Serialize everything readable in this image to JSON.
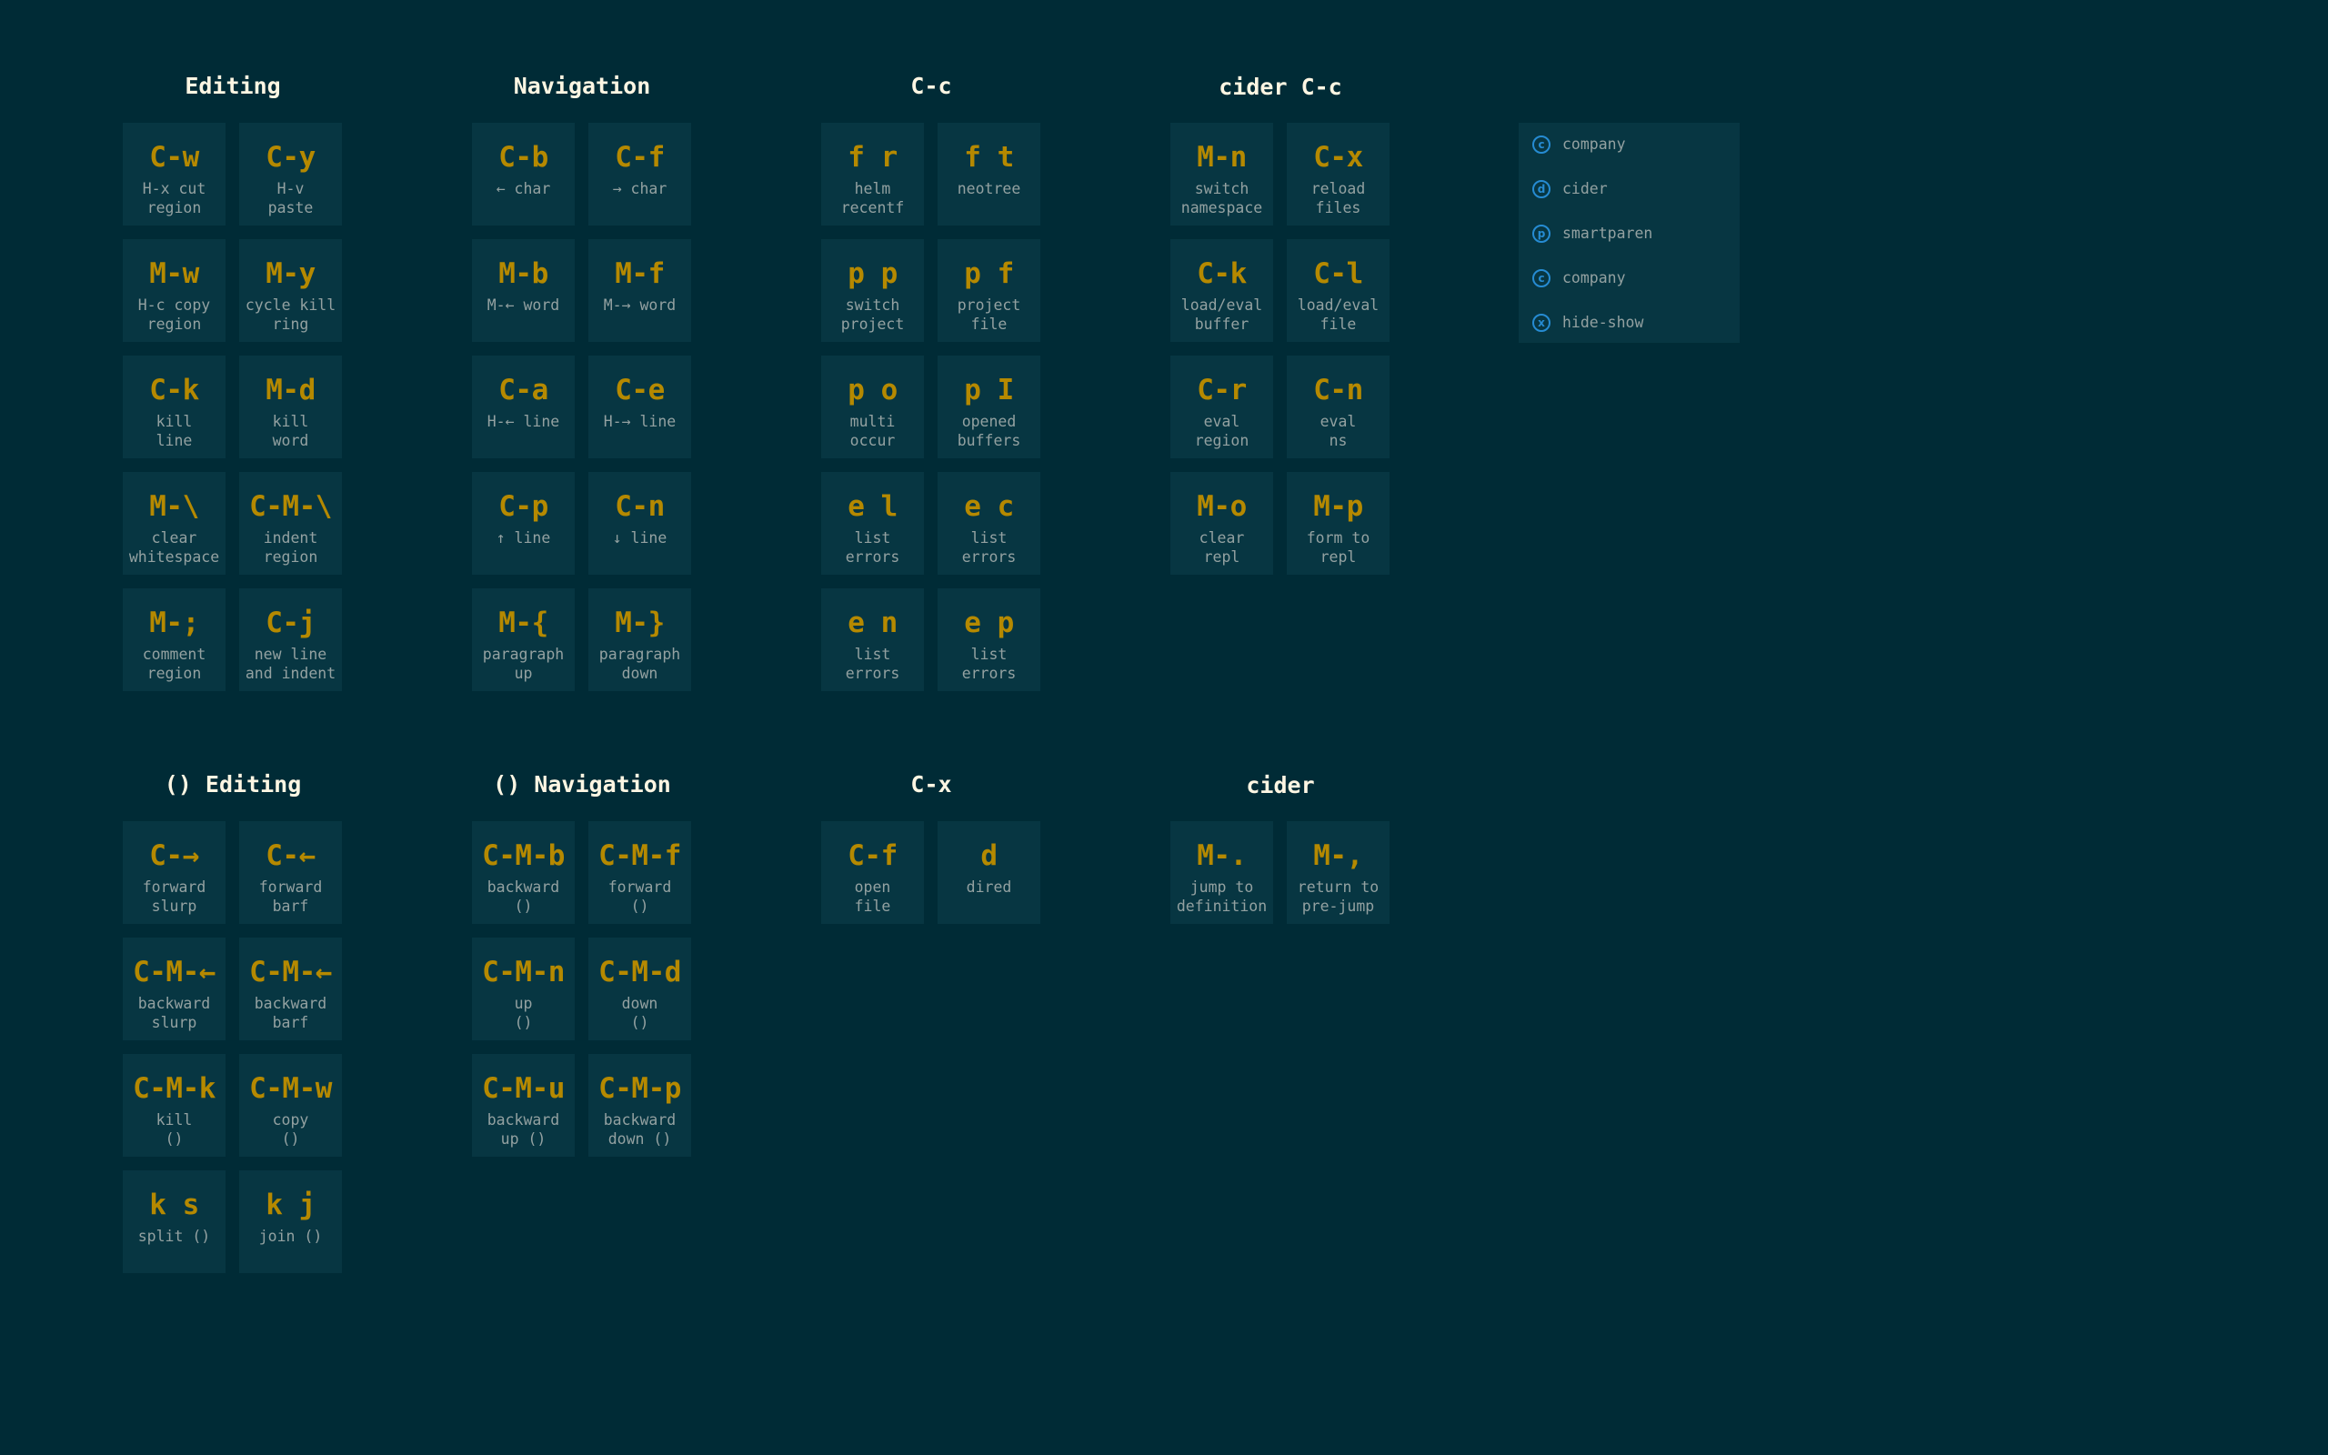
{
  "groups": [
    {
      "id": "editing",
      "title": "Editing",
      "tiles": [
        {
          "key": "C-w",
          "desc": "H-x cut\nregion"
        },
        {
          "key": "C-y",
          "desc": "H-v\npaste"
        },
        {
          "key": "M-w",
          "desc": "H-c copy\nregion"
        },
        {
          "key": "M-y",
          "desc": "cycle kill\nring"
        },
        {
          "key": "C-k",
          "desc": "kill\nline"
        },
        {
          "key": "M-d",
          "desc": "kill\nword"
        },
        {
          "key": "M-\\",
          "desc": "clear\nwhitespace"
        },
        {
          "key": "C-M-\\",
          "desc": "indent\nregion"
        },
        {
          "key": "M-;",
          "desc": "comment\nregion"
        },
        {
          "key": "C-j",
          "desc": "new line\nand indent"
        }
      ]
    },
    {
      "id": "navigation",
      "title": "Navigation",
      "tiles": [
        {
          "key": "C-b",
          "desc": "← char"
        },
        {
          "key": "C-f",
          "desc": "→ char"
        },
        {
          "key": "M-b",
          "desc": "M-← word"
        },
        {
          "key": "M-f",
          "desc": "M-→ word"
        },
        {
          "key": "C-a",
          "desc": "H-← line"
        },
        {
          "key": "C-e",
          "desc": "H-→ line"
        },
        {
          "key": "C-p",
          "desc": "↑ line"
        },
        {
          "key": "C-n",
          "desc": "↓ line"
        },
        {
          "key": "M-{",
          "desc": "paragraph\nup"
        },
        {
          "key": "M-}",
          "desc": "paragraph\ndown"
        }
      ]
    },
    {
      "id": "c-c",
      "title": "C-c",
      "tiles": [
        {
          "key": "f r",
          "desc": "helm\nrecentf"
        },
        {
          "key": "f t",
          "desc": "neotree"
        },
        {
          "key": "p p",
          "desc": "switch\nproject"
        },
        {
          "key": "p f",
          "desc": "project\nfile"
        },
        {
          "key": "p o",
          "desc": "multi\noccur"
        },
        {
          "key": "p I",
          "desc": "opened\nbuffers"
        },
        {
          "key": "e l",
          "desc": "list\nerrors"
        },
        {
          "key": "e c",
          "desc": "list\nerrors"
        },
        {
          "key": "e n",
          "desc": "list\nerrors"
        },
        {
          "key": "e p",
          "desc": "list\nerrors"
        }
      ]
    },
    {
      "id": "cider-c-c",
      "title": "cider C-c",
      "tiles": [
        {
          "key": "M-n",
          "desc": "switch\nnamespace"
        },
        {
          "key": "C-x",
          "desc": "reload\nfiles"
        },
        {
          "key": "C-k",
          "desc": "load/eval\nbuffer"
        },
        {
          "key": "C-l",
          "desc": "load/eval\nfile"
        },
        {
          "key": "C-r",
          "desc": "eval\nregion"
        },
        {
          "key": "C-n",
          "desc": "eval\nns"
        },
        {
          "key": "M-o",
          "desc": "clear\nrepl"
        },
        {
          "key": "M-p",
          "desc": "form to\nrepl"
        }
      ]
    },
    {
      "id": "paren-editing",
      "title": "() Editing",
      "tiles": [
        {
          "key": "C-→",
          "desc": "forward\nslurp"
        },
        {
          "key": "C-←",
          "desc": "forward\nbarf"
        },
        {
          "key": "C-M-←",
          "desc": "backward\nslurp"
        },
        {
          "key": "C-M-←",
          "desc": "backward\nbarf"
        },
        {
          "key": "C-M-k",
          "desc": "kill\n()"
        },
        {
          "key": "C-M-w",
          "desc": "copy\n()"
        },
        {
          "key": "k s",
          "desc": "split ()"
        },
        {
          "key": "k j",
          "desc": "join ()"
        }
      ]
    },
    {
      "id": "paren-navigation",
      "title": "() Navigation",
      "tiles": [
        {
          "key": "C-M-b",
          "desc": "backward\n()"
        },
        {
          "key": "C-M-f",
          "desc": "forward\n()"
        },
        {
          "key": "C-M-n",
          "desc": "up\n()"
        },
        {
          "key": "C-M-d",
          "desc": "down\n()"
        },
        {
          "key": "C-M-u",
          "desc": "backward\nup ()"
        },
        {
          "key": "C-M-p",
          "desc": "backward\ndown ()"
        }
      ]
    },
    {
      "id": "c-x",
      "title": "C-x",
      "tiles": [
        {
          "key": "C-f",
          "desc": "open\nfile"
        },
        {
          "key": "d",
          "desc": "dired"
        }
      ]
    },
    {
      "id": "cider",
      "title": "cider",
      "tiles": [
        {
          "key": "M-.",
          "desc": "jump to\ndefinition"
        },
        {
          "key": "M-,",
          "desc": "return to\npre-jump"
        }
      ]
    }
  ],
  "legend": {
    "items": [
      {
        "glyph": "c",
        "label": "company",
        "icon": "company-icon"
      },
      {
        "glyph": "d",
        "label": "cider",
        "icon": "cider-icon"
      },
      {
        "glyph": "p",
        "label": "smartparen",
        "icon": "smartparen-icon"
      },
      {
        "glyph": "c",
        "label": "company",
        "icon": "company-icon"
      },
      {
        "glyph": "x",
        "label": "hide-show",
        "icon": "hide-show-icon"
      }
    ]
  },
  "colors": {
    "background": "#002b36",
    "tile": "#073642",
    "key": "#b58900",
    "description": "#93a1a1",
    "title": "#fdf6e3",
    "accent": "#268bd2"
  }
}
